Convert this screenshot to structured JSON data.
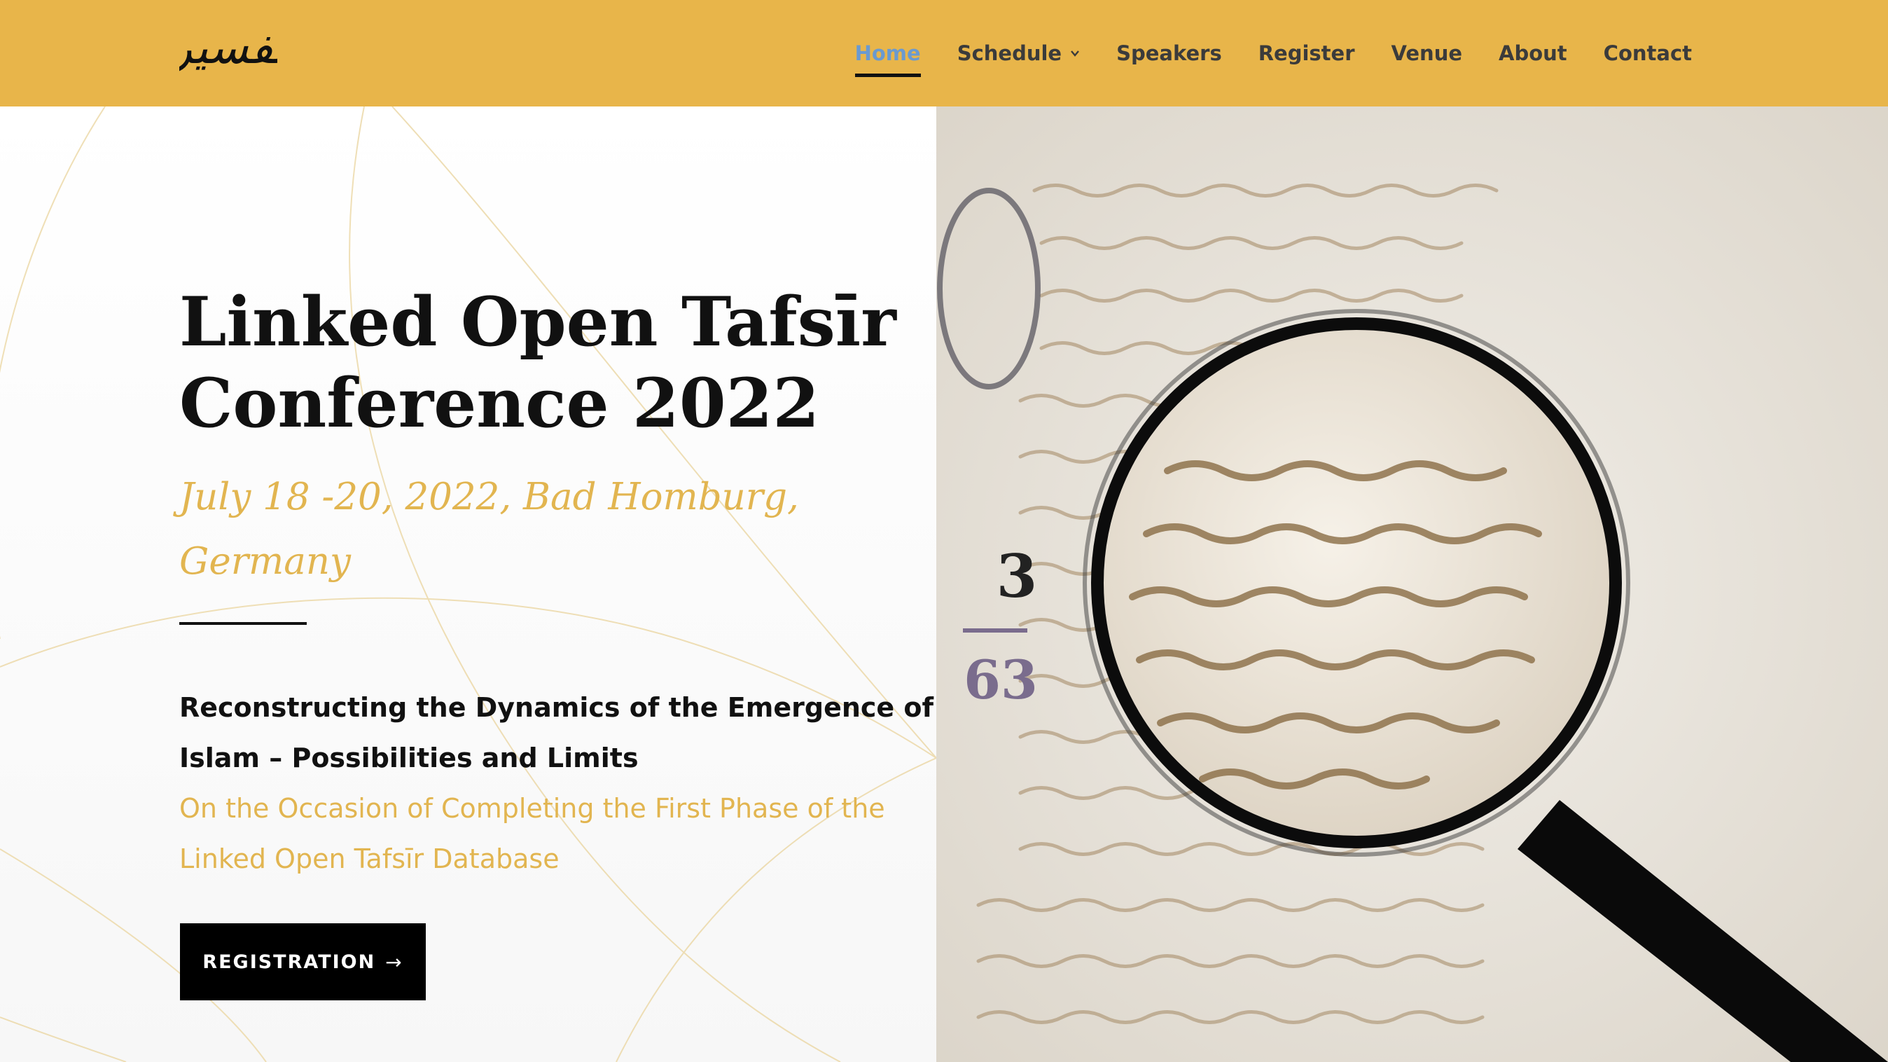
{
  "header": {
    "logo_text": "تفسير",
    "nav": [
      {
        "label": "Home",
        "active": true
      },
      {
        "label": "Schedule",
        "dropdown": true
      },
      {
        "label": "Speakers"
      },
      {
        "label": "Register"
      },
      {
        "label": "Venue"
      },
      {
        "label": "About"
      },
      {
        "label": "Contact"
      }
    ]
  },
  "hero": {
    "title": "Linked Open Tafsīr Conference 2022",
    "date_location": "July 18 -20, 2022, Bad Homburg, Germany",
    "subtitle": "Reconstructing the Dynamics of the Emergence of Islam – Possibilities and Limits",
    "occasion": "On the Occasion of Completing the First Phase of the Linked Open Tafsīr Database",
    "button_label": "REGISTRATION",
    "button_icon": "arrow-right-icon"
  },
  "image": {
    "description_icon": "manuscript-magnifier-image",
    "folio_number": "3",
    "folio_sub": "63"
  },
  "colors": {
    "header_bg": "#e8b54a",
    "accent_gold": "#e2b550",
    "nav_active": "#6a9ad0",
    "button_bg": "#000000"
  }
}
